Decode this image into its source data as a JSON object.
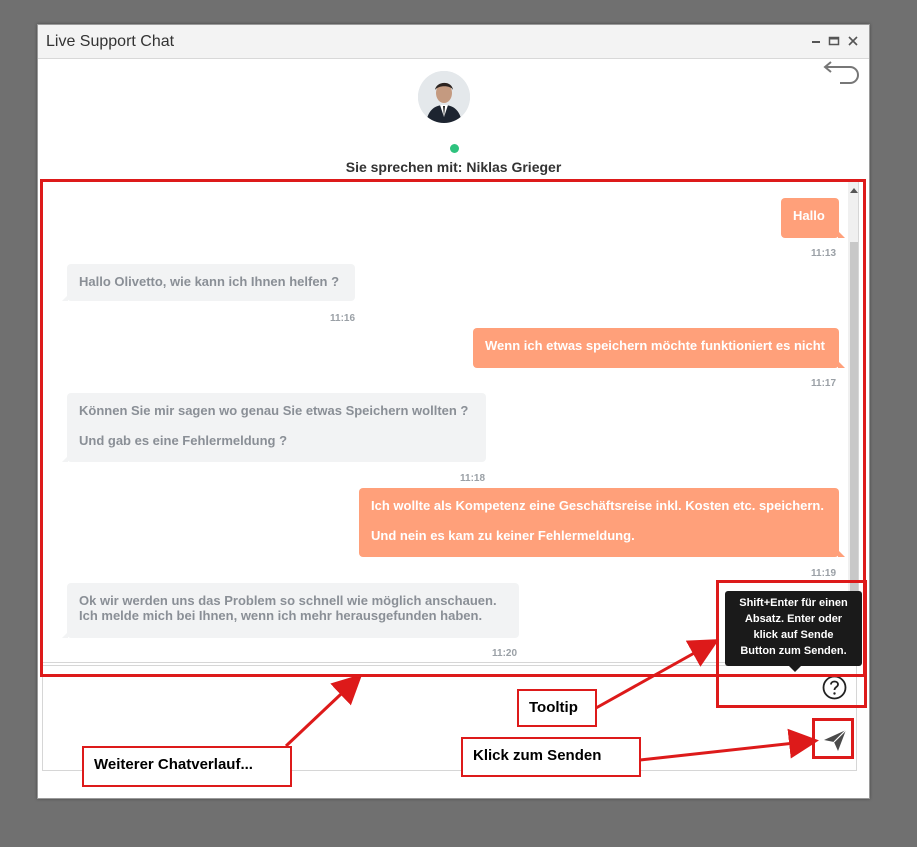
{
  "window": {
    "title": "Live Support Chat"
  },
  "agent": {
    "speaking_with": "Sie sprechen mit: Niklas Grieger",
    "status_color": "#2ec27e"
  },
  "colors": {
    "outgoing": "#ffa07a",
    "incoming": "#f2f3f4",
    "annotation": "#dd1a1a"
  },
  "messages": [
    {
      "from": "user",
      "lines": [
        "Hallo"
      ],
      "time": "11:13"
    },
    {
      "from": "agent",
      "lines": [
        "Hallo Olivetto, wie kann ich Ihnen helfen ?"
      ],
      "time": "11:16"
    },
    {
      "from": "user",
      "lines": [
        "Wenn ich etwas speichern möchte funktioniert es nicht"
      ],
      "time": "11:17"
    },
    {
      "from": "agent",
      "lines": [
        "Können Sie mir sagen wo genau Sie etwas Speichern wollten ?",
        "Und gab es eine Fehlermeldung ?"
      ],
      "time": "11:18"
    },
    {
      "from": "user",
      "lines": [
        "Ich wollte als Kompetenz eine Geschäftsreise inkl. Kosten etc. speichern.",
        "Und nein es kam zu keiner Fehlermeldung."
      ],
      "time": "11:19"
    },
    {
      "from": "agent",
      "lines": [
        "Ok wir werden uns das Problem so schnell wie möglich anschauen.",
        "Ich melde mich bei Ihnen, wenn ich mehr herausgefunden haben."
      ],
      "time": "11:20"
    }
  ],
  "tooltip": {
    "lines": [
      "Shift+Enter für einen",
      "Absatz. Enter oder",
      "klick auf Sende",
      "Button zum Senden."
    ]
  },
  "icons": {
    "help": "question-circle-icon",
    "send": "paper-plane-icon",
    "back": "undo-arrow-icon"
  },
  "annotations": {
    "tooltip_label": "Tooltip",
    "send_label": "Klick zum Senden",
    "history_label": "Weiterer Chatverlauf..."
  }
}
